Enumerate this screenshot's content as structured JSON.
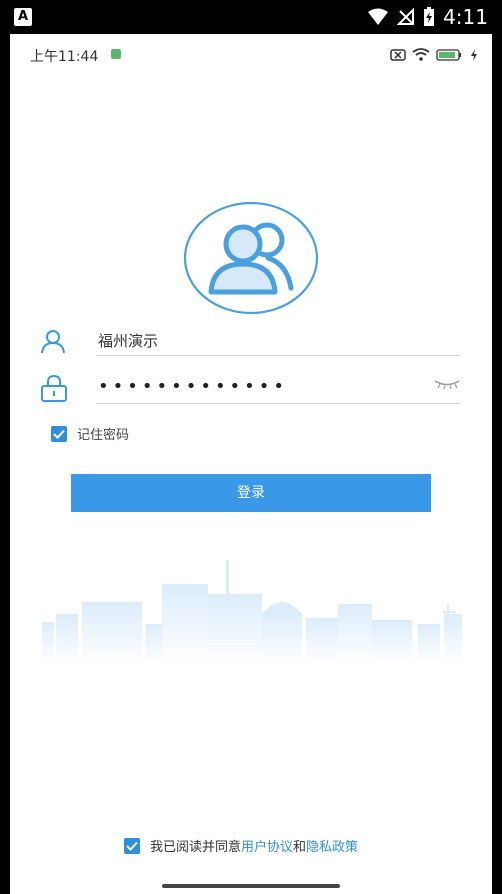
{
  "system_bar": {
    "app_letter": "A",
    "time": "4:11"
  },
  "inner_status": {
    "time": "上午11:44"
  },
  "login": {
    "username": "福州演示",
    "password_mask": "•••••••••••••",
    "remember_label": "记住密码",
    "login_button": "登录"
  },
  "agreement": {
    "prefix": "我已阅读并同意",
    "user_agreement": "用户协议",
    "and": "和",
    "privacy_policy": "隐私政策"
  },
  "colors": {
    "accent": "#3a98e8",
    "link": "#2f8fe0"
  }
}
